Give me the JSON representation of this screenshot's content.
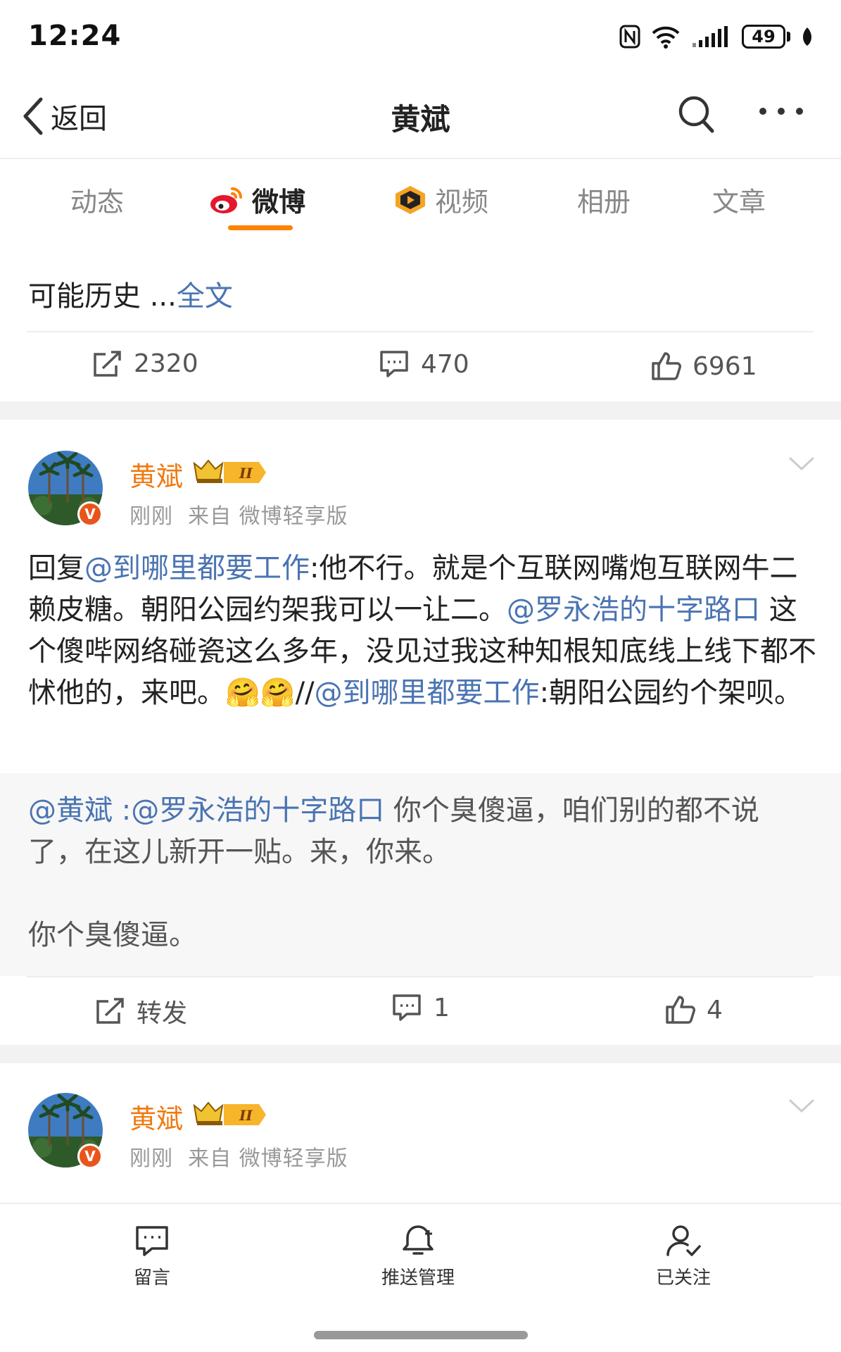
{
  "status_bar": {
    "time": "12:24",
    "battery": "49"
  },
  "nav": {
    "back_label": "返回",
    "title": "黄斌"
  },
  "tabs": [
    {
      "label": "动态"
    },
    {
      "label": "微博"
    },
    {
      "label": "视频"
    },
    {
      "label": "相册"
    },
    {
      "label": "文章"
    }
  ],
  "truncated_post": {
    "text": "可能历史 ...",
    "more_label": "全文",
    "repost_count": "2320",
    "comment_count": "470",
    "like_count": "6961"
  },
  "post1": {
    "author": "黄斌",
    "crown_level": "II",
    "time": "刚刚",
    "source": "来自 微博轻享版",
    "body_segments": [
      {
        "text": "回复",
        "link": false
      },
      {
        "text": "@到哪里都要工作",
        "link": true
      },
      {
        "text": ":他不行。就是个互联网嘴炮互联网牛二赖皮糖。朝阳公园约架我可以一让二。",
        "link": false
      },
      {
        "text": "@罗永浩的十字路口",
        "link": true
      },
      {
        "text": " 这个傻哔网络碰瓷这么多年，没见过我这种知根知底线上线下都不怵他的，来吧。🤗🤗//",
        "link": false
      },
      {
        "text": "@到哪里都要工作",
        "link": true
      },
      {
        "text": ":朝阳公园约个架呗。",
        "link": false
      }
    ],
    "quote_segments": [
      {
        "text": "@黄斌 :",
        "link": true
      },
      {
        "text": "@罗永浩的十字路口",
        "link": true
      },
      {
        "text": " 你个臭傻逼，咱们别的都不说了，在这儿新开一贴。来，你来。",
        "link": false
      }
    ],
    "quote_line2": "你个臭傻逼。",
    "repost_label": "转发",
    "comment_count": "1",
    "like_count": "4"
  },
  "post2": {
    "author": "黄斌",
    "crown_level": "II",
    "time": "刚刚",
    "source": "来自 微博轻享版"
  },
  "bottom_bar": [
    {
      "label": "留言",
      "icon": "comment-bubble-icon"
    },
    {
      "label": "推送管理",
      "icon": "bell-plus-icon"
    },
    {
      "label": "已关注",
      "icon": "user-check-icon"
    }
  ],
  "colors": {
    "accent": "#ff8200",
    "link": "#4a74b2",
    "username": "#f07a10"
  }
}
